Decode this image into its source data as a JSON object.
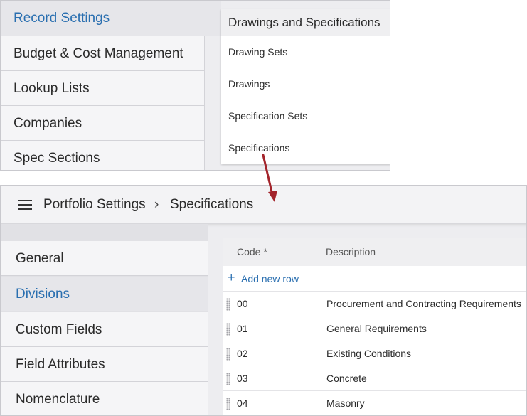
{
  "record_settings": {
    "title": "Record Settings",
    "items": [
      "Budget & Cost Management",
      "Lookup Lists",
      "Companies",
      "Spec Sections"
    ]
  },
  "dropdown": {
    "header": "Drawings and Specifications",
    "items": [
      "Drawing Sets",
      "Drawings",
      "Specification Sets",
      "Specifications"
    ]
  },
  "breadcrumb": {
    "root": "Portfolio Settings",
    "separator": "›",
    "current": "Specifications"
  },
  "side_nav": {
    "items": [
      {
        "label": "General",
        "active": false
      },
      {
        "label": "Divisions",
        "active": true
      },
      {
        "label": "Custom Fields",
        "active": false
      },
      {
        "label": "Field Attributes",
        "active": false
      },
      {
        "label": "Nomenclature",
        "active": false
      }
    ]
  },
  "table": {
    "columns": [
      "Code *",
      "Description"
    ],
    "add_row_label": "Add new row",
    "rows": [
      {
        "code": "00",
        "description": "Procurement and Contracting Requirements"
      },
      {
        "code": "01",
        "description": "General Requirements"
      },
      {
        "code": "02",
        "description": "Existing Conditions"
      },
      {
        "code": "03",
        "description": "Concrete"
      },
      {
        "code": "04",
        "description": "Masonry"
      }
    ]
  },
  "colors": {
    "accent": "#2a6fb0",
    "arrow": "#a3242b"
  }
}
